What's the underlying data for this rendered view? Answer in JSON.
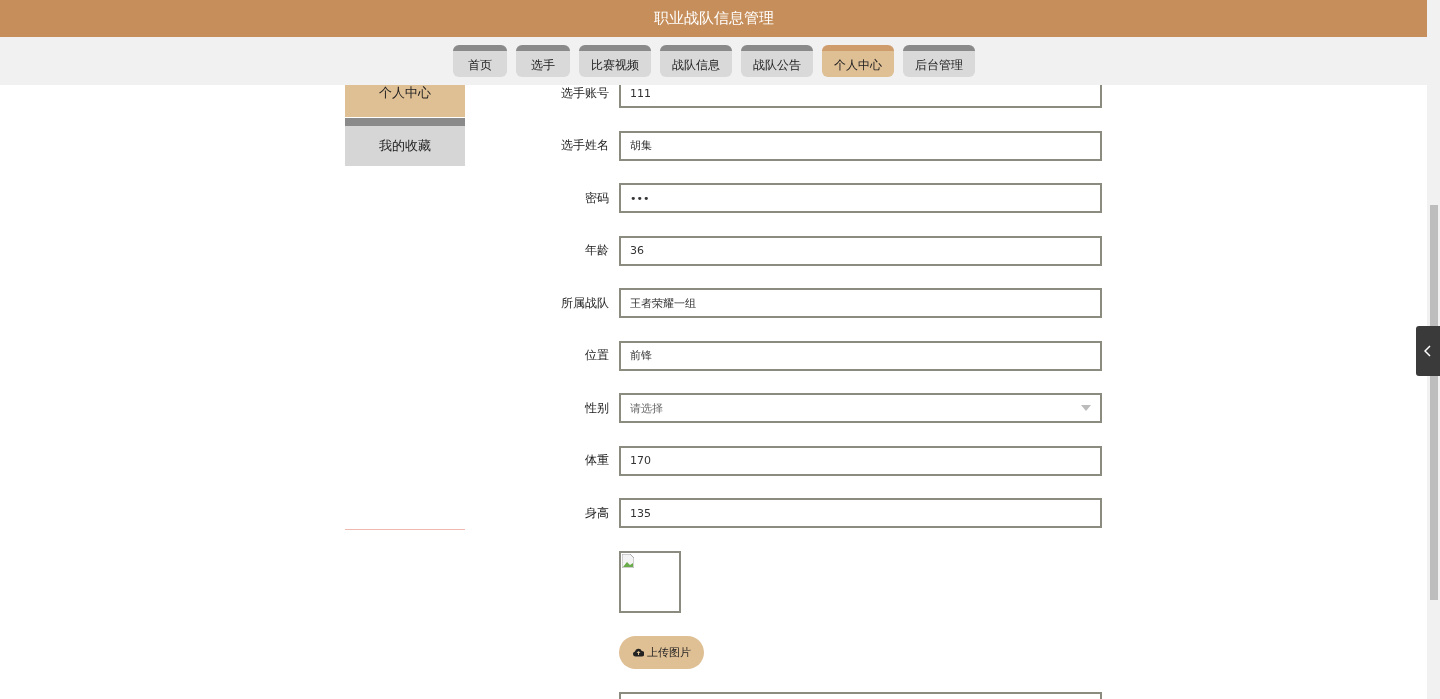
{
  "header": {
    "title": "职业战队信息管理"
  },
  "nav": [
    {
      "label": "首页",
      "selected": false
    },
    {
      "label": "选手",
      "selected": false
    },
    {
      "label": "比赛视频",
      "selected": false
    },
    {
      "label": "战队信息",
      "selected": false
    },
    {
      "label": "战队公告",
      "selected": false
    },
    {
      "label": "个人中心",
      "selected": true
    },
    {
      "label": "后台管理",
      "selected": false
    }
  ],
  "sidebar": [
    {
      "label": "个人中心",
      "selected": true
    },
    {
      "label": "我的收藏",
      "selected": false
    }
  ],
  "form": [
    {
      "kind": "text",
      "label": "选手账号",
      "value": "111"
    },
    {
      "kind": "text",
      "label": "选手姓名",
      "value": "胡集"
    },
    {
      "kind": "password",
      "label": "密码",
      "value": "•••"
    },
    {
      "kind": "text",
      "label": "年龄",
      "value": "36"
    },
    {
      "kind": "text",
      "label": "所属战队",
      "value": "王者荣耀一组"
    },
    {
      "kind": "text",
      "label": "位置",
      "value": "前锋"
    },
    {
      "kind": "select",
      "label": "性别",
      "placeholder": "请选择"
    },
    {
      "kind": "text",
      "label": "体重",
      "value": "170"
    },
    {
      "kind": "text",
      "label": "身高",
      "value": "135"
    },
    {
      "kind": "image"
    },
    {
      "kind": "upload",
      "label": "上传图片"
    },
    {
      "kind": "text"
    }
  ]
}
